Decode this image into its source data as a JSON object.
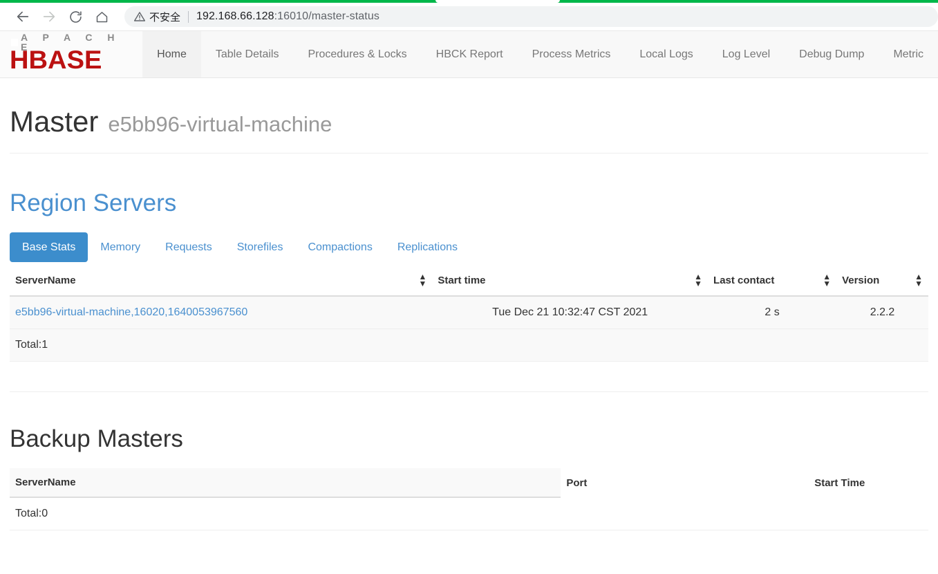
{
  "browser": {
    "back_icon": "arrow-left-icon",
    "forward_icon": "arrow-right-icon",
    "reload_icon": "reload-icon",
    "home_icon": "home-icon",
    "security_icon": "warning-triangle-icon",
    "security_label": "不安全",
    "url_host": "192.168.66.128",
    "url_port": ":16010",
    "url_path": "/master-status",
    "accent_green": "#00b74a"
  },
  "navbar": {
    "brand": {
      "apache": "A P A C H E",
      "hbase": "HBASE",
      "hbase_color": "#bb1111",
      "apache_color": "#8a8a8a"
    },
    "links": [
      {
        "label": "Home",
        "active": true
      },
      {
        "label": "Table Details",
        "active": false
      },
      {
        "label": "Procedures & Locks",
        "active": false
      },
      {
        "label": "HBCK Report",
        "active": false
      },
      {
        "label": "Process Metrics",
        "active": false
      },
      {
        "label": "Local Logs",
        "active": false
      },
      {
        "label": "Log Level",
        "active": false
      },
      {
        "label": "Debug Dump",
        "active": false
      },
      {
        "label": "Metric",
        "active": false
      }
    ]
  },
  "master": {
    "title": "Master",
    "hostname": "e5bb96-virtual-machine"
  },
  "region_servers": {
    "heading": "Region Servers",
    "heading_color": "#4a90cf",
    "tabs": [
      {
        "label": "Base Stats",
        "active": true
      },
      {
        "label": "Memory",
        "active": false
      },
      {
        "label": "Requests",
        "active": false
      },
      {
        "label": "Storefiles",
        "active": false
      },
      {
        "label": "Compactions",
        "active": false
      },
      {
        "label": "Replications",
        "active": false
      }
    ],
    "active_tab_bg": "#3c8dcc",
    "columns": [
      "ServerName",
      "Start time",
      "Last contact",
      "Version"
    ],
    "sort_icon": "sort-updown-icon",
    "rows": [
      {
        "server_name": "e5bb96-virtual-machine,16020,1640053967560",
        "start_time": "Tue Dec 21 10:32:47 CST 2021",
        "last_contact": "2 s",
        "version": "2.2.2"
      }
    ],
    "total": "Total:1"
  },
  "backup_masters": {
    "heading": "Backup Masters",
    "columns": [
      "ServerName",
      "Port",
      "Start Time"
    ],
    "rows": [],
    "total": "Total:0"
  }
}
